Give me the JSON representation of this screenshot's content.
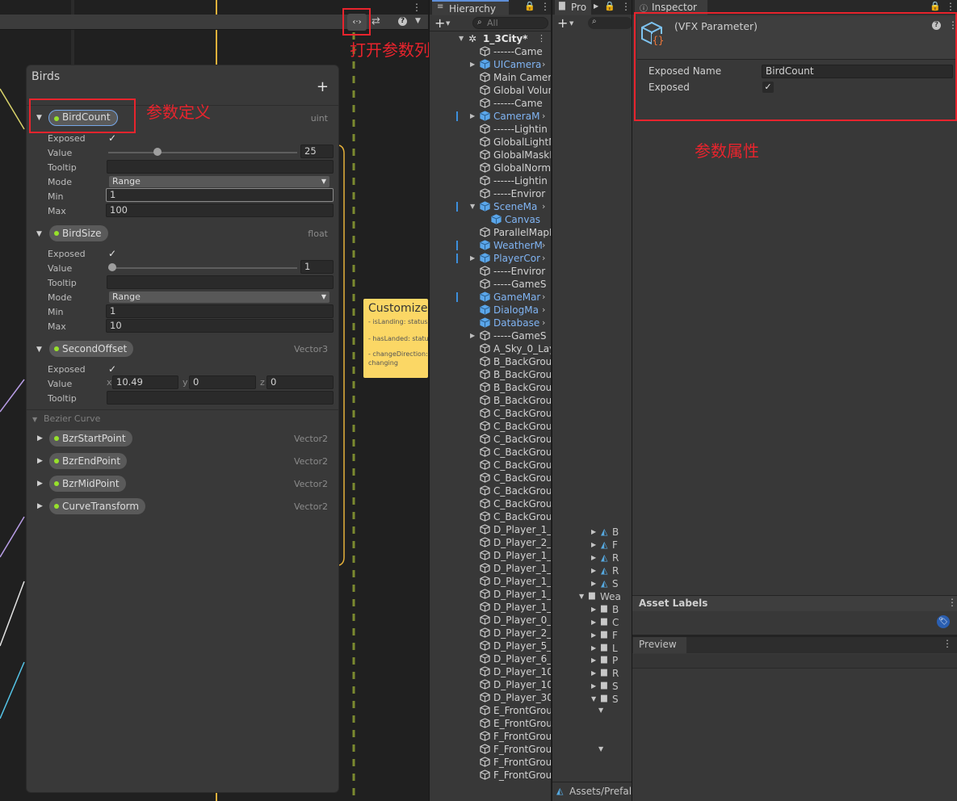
{
  "annotations": {
    "open_list": "打开参数列表",
    "param_def": "参数定义",
    "param_attr": "参数属性"
  },
  "blackboard": {
    "title": "Birds",
    "add": "+",
    "params": [
      {
        "name": "BirdCount",
        "type": "uint",
        "exposed_label": "Exposed",
        "value_label": "Value",
        "value": "25",
        "slider_fraction": 0.25,
        "tooltip_label": "Tooltip",
        "mode_label": "Mode",
        "mode": "Range",
        "min_label": "Min",
        "min": "1",
        "max_label": "Max",
        "max": "100"
      },
      {
        "name": "BirdSize",
        "type": "float",
        "exposed_label": "Exposed",
        "value_label": "Value",
        "value": "1",
        "slider_fraction": 0.0,
        "tooltip_label": "Tooltip",
        "mode_label": "Mode",
        "mode": "Range",
        "min_label": "Min",
        "min": "1",
        "max_label": "Max",
        "max": "10"
      },
      {
        "name": "SecondOffset",
        "type": "Vector3",
        "exposed_label": "Exposed",
        "value_label": "Value",
        "x_label": "x",
        "x": "10.49",
        "y_label": "y",
        "y": "0",
        "z_label": "z",
        "z": "0",
        "tooltip_label": "Tooltip"
      }
    ],
    "category": "Bezier Curve",
    "curve_params": [
      {
        "name": "BzrStartPoint",
        "type": "Vector2"
      },
      {
        "name": "BzrEndPoint",
        "type": "Vector2"
      },
      {
        "name": "BzrMidPoint",
        "type": "Vector2"
      },
      {
        "name": "CurveTransform",
        "type": "Vector2"
      }
    ]
  },
  "sticky": {
    "title": "Customize",
    "lines": [
      "- isLanding: status",
      "- hasLanded: status",
      "- changeDirection:",
      "changing"
    ]
  },
  "hierarchy": {
    "tab": "Hierarchy",
    "search_placeholder": "All",
    "scene": "1_3City*",
    "items": [
      {
        "label": "------Came",
        "blue": false,
        "arrow": ""
      },
      {
        "label": "UICamera",
        "blue": true,
        "arrow": "right",
        "more": true
      },
      {
        "label": "Main Camera",
        "blue": false,
        "arrow": ""
      },
      {
        "label": "Global Volun",
        "blue": false,
        "arrow": ""
      },
      {
        "label": "------Came",
        "blue": false,
        "arrow": ""
      },
      {
        "label": "CameraM",
        "blue": true,
        "arrow": "right",
        "more": true,
        "mark": true
      },
      {
        "label": "------Lightin",
        "blue": false,
        "arrow": ""
      },
      {
        "label": "GlobalLightM",
        "blue": false,
        "arrow": ""
      },
      {
        "label": "GlobalMaskL",
        "blue": false,
        "arrow": ""
      },
      {
        "label": "GlobalNorma",
        "blue": false,
        "arrow": ""
      },
      {
        "label": "------Lightin",
        "blue": false,
        "arrow": ""
      },
      {
        "label": "-----Enviror",
        "blue": false,
        "arrow": ""
      },
      {
        "label": "SceneMa",
        "blue": true,
        "arrow": "down",
        "more": true,
        "mark": true
      },
      {
        "label": "Canvas",
        "blue": true,
        "arrow": "",
        "indent": true
      },
      {
        "label": "ParallelMapM",
        "blue": false,
        "arrow": ""
      },
      {
        "label": "WeatherM",
        "blue": true,
        "arrow": "",
        "more": true,
        "mark": true
      },
      {
        "label": "PlayerCor",
        "blue": true,
        "arrow": "right",
        "more": true,
        "mark": true
      },
      {
        "label": "-----Enviror",
        "blue": false,
        "arrow": ""
      },
      {
        "label": "-----GameS",
        "blue": false,
        "arrow": ""
      },
      {
        "label": "GameMar",
        "blue": true,
        "arrow": "",
        "more": true,
        "mark": true
      },
      {
        "label": "DialogMa",
        "blue": true,
        "arrow": "",
        "more": true
      },
      {
        "label": "Database",
        "blue": true,
        "arrow": "",
        "more": true
      },
      {
        "label": "-----GameS",
        "blue": false,
        "arrow": "right"
      },
      {
        "label": "A_Sky_0_Lay",
        "blue": false,
        "arrow": ""
      },
      {
        "label": "B_BackGrou",
        "blue": false,
        "arrow": ""
      },
      {
        "label": "B_BackGrou",
        "blue": false,
        "arrow": ""
      },
      {
        "label": "B_BackGrou",
        "blue": false,
        "arrow": ""
      },
      {
        "label": "B_BackGrou",
        "blue": false,
        "arrow": ""
      },
      {
        "label": "C_BackGrou",
        "blue": false,
        "arrow": ""
      },
      {
        "label": "C_BackGrou",
        "blue": false,
        "arrow": ""
      },
      {
        "label": "C_BackGrou",
        "blue": false,
        "arrow": ""
      },
      {
        "label": "C_BackGrou",
        "blue": false,
        "arrow": ""
      },
      {
        "label": "C_BackGrou",
        "blue": false,
        "arrow": ""
      },
      {
        "label": "C_BackGrou",
        "blue": false,
        "arrow": ""
      },
      {
        "label": "C_BackGrou",
        "blue": false,
        "arrow": ""
      },
      {
        "label": "C_BackGrou",
        "blue": false,
        "arrow": ""
      },
      {
        "label": "C_BackGrou",
        "blue": false,
        "arrow": ""
      },
      {
        "label": "D_Player_1_L",
        "blue": false,
        "arrow": ""
      },
      {
        "label": "D_Player_2_L",
        "blue": false,
        "arrow": ""
      },
      {
        "label": "D_Player_1_L",
        "blue": false,
        "arrow": ""
      },
      {
        "label": "D_Player_1_L",
        "blue": false,
        "arrow": ""
      },
      {
        "label": "D_Player_1_L",
        "blue": false,
        "arrow": ""
      },
      {
        "label": "D_Player_1_L",
        "blue": false,
        "arrow": ""
      },
      {
        "label": "D_Player_1_L",
        "blue": false,
        "arrow": ""
      },
      {
        "label": "D_Player_0_L",
        "blue": false,
        "arrow": ""
      },
      {
        "label": "D_Player_2_L",
        "blue": false,
        "arrow": ""
      },
      {
        "label": "D_Player_5_L",
        "blue": false,
        "arrow": ""
      },
      {
        "label": "D_Player_6_L",
        "blue": false,
        "arrow": ""
      },
      {
        "label": "D_Player_10_",
        "blue": false,
        "arrow": ""
      },
      {
        "label": "D_Player_10_",
        "blue": false,
        "arrow": ""
      },
      {
        "label": "D_Player_30_",
        "blue": false,
        "arrow": ""
      },
      {
        "label": "E_FrontGrou",
        "blue": false,
        "arrow": ""
      },
      {
        "label": "E_FrontGrou",
        "blue": false,
        "arrow": ""
      },
      {
        "label": "F_FrontGrou",
        "blue": false,
        "arrow": ""
      },
      {
        "label": "F_FrontGrou",
        "blue": false,
        "arrow": ""
      },
      {
        "label": "F_FrontGrou",
        "blue": false,
        "arrow": ""
      },
      {
        "label": "F_FrontGrou",
        "blue": false,
        "arrow": ""
      }
    ]
  },
  "project": {
    "tab": "Pro",
    "path": "Assets/Prefal",
    "items": [
      "B",
      "F",
      "R",
      "R",
      "S",
      "Wea",
      "B",
      "C",
      "F",
      "L",
      "P",
      "R",
      "S",
      "S"
    ]
  },
  "inspector": {
    "tab": "Inspector",
    "component": "(VFX Parameter)",
    "exposed_name_label": "Exposed Name",
    "exposed_name": "BirdCount",
    "exposed_label": "Exposed",
    "asset_labels": "Asset Labels",
    "preview": "Preview"
  }
}
